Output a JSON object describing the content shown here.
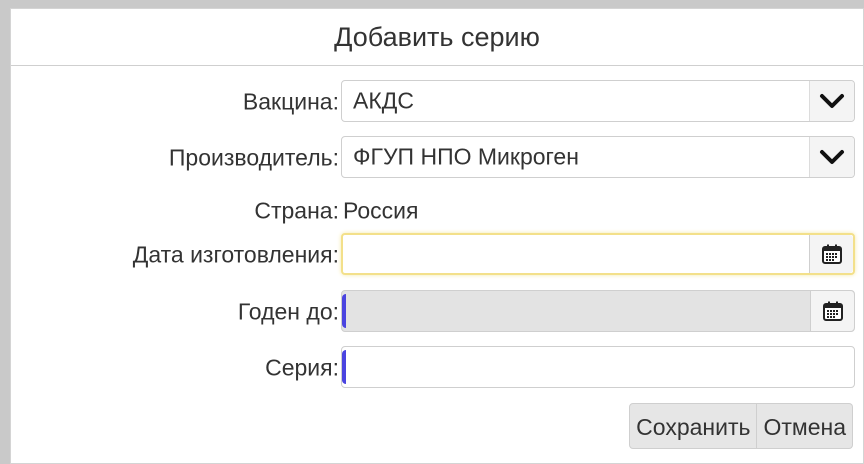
{
  "dialog": {
    "title": "Добавить серию"
  },
  "form": {
    "vaccine": {
      "label": "Вакцина:",
      "value": "АКДС"
    },
    "manufacturer": {
      "label": "Производитель:",
      "value": "ФГУП НПО Микроген"
    },
    "country": {
      "label": "Страна:",
      "value": "Россия"
    },
    "manufacture_date": {
      "label": "Дата изготовления:",
      "value": ""
    },
    "expiry_date": {
      "label": "Годен до:",
      "value": ""
    },
    "series": {
      "label": "Серия:",
      "value": ""
    }
  },
  "buttons": {
    "save": "Сохранить",
    "cancel": "Отмена"
  },
  "icons": {
    "dropdown": "chevron-down-icon",
    "date_picker": "calendar-icon"
  },
  "colors": {
    "focus_border": "#f3e08a",
    "required_marker": "#4a44e0",
    "disabled_bg": "#e3e3e3"
  }
}
